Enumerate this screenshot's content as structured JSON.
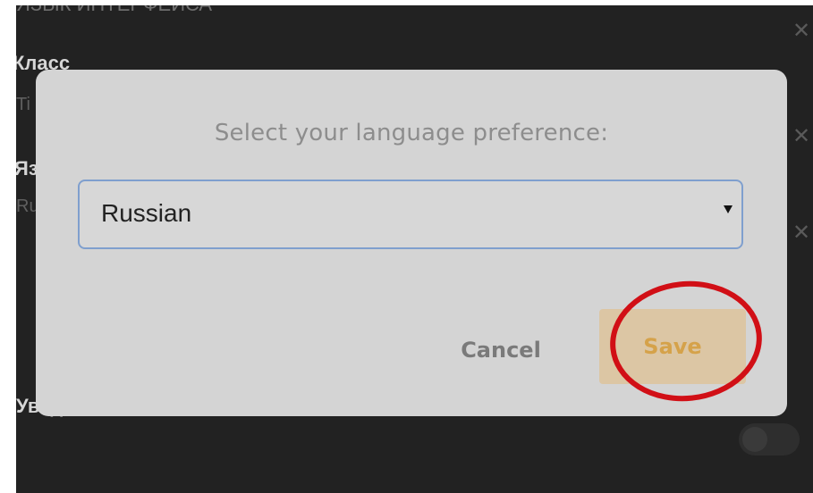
{
  "background": {
    "top_text": "ЯЗЫК ИНТЕРФЕЙСА",
    "heading_1": "Класс",
    "sub_1": "Ti",
    "heading_2": "Язык",
    "sub_2": "Rus",
    "heading_3": "Уведомления"
  },
  "dialog": {
    "prompt": "Select your language preference:",
    "selected_language": "Russian",
    "cancel_label": "Cancel",
    "save_label": "Save"
  },
  "annotation": {
    "circle_color": "#d10f16"
  },
  "colors": {
    "dialog_background": "#d4d4d4",
    "select_border": "#7f9fce",
    "save_button_background": "#dcc6a4",
    "save_text": "#d5a24a",
    "cancel_text": "#7a7a7a",
    "overlay": "#222222"
  },
  "icons": {
    "dropdown": "triangle-down-icon",
    "background_close": "close-icon"
  }
}
